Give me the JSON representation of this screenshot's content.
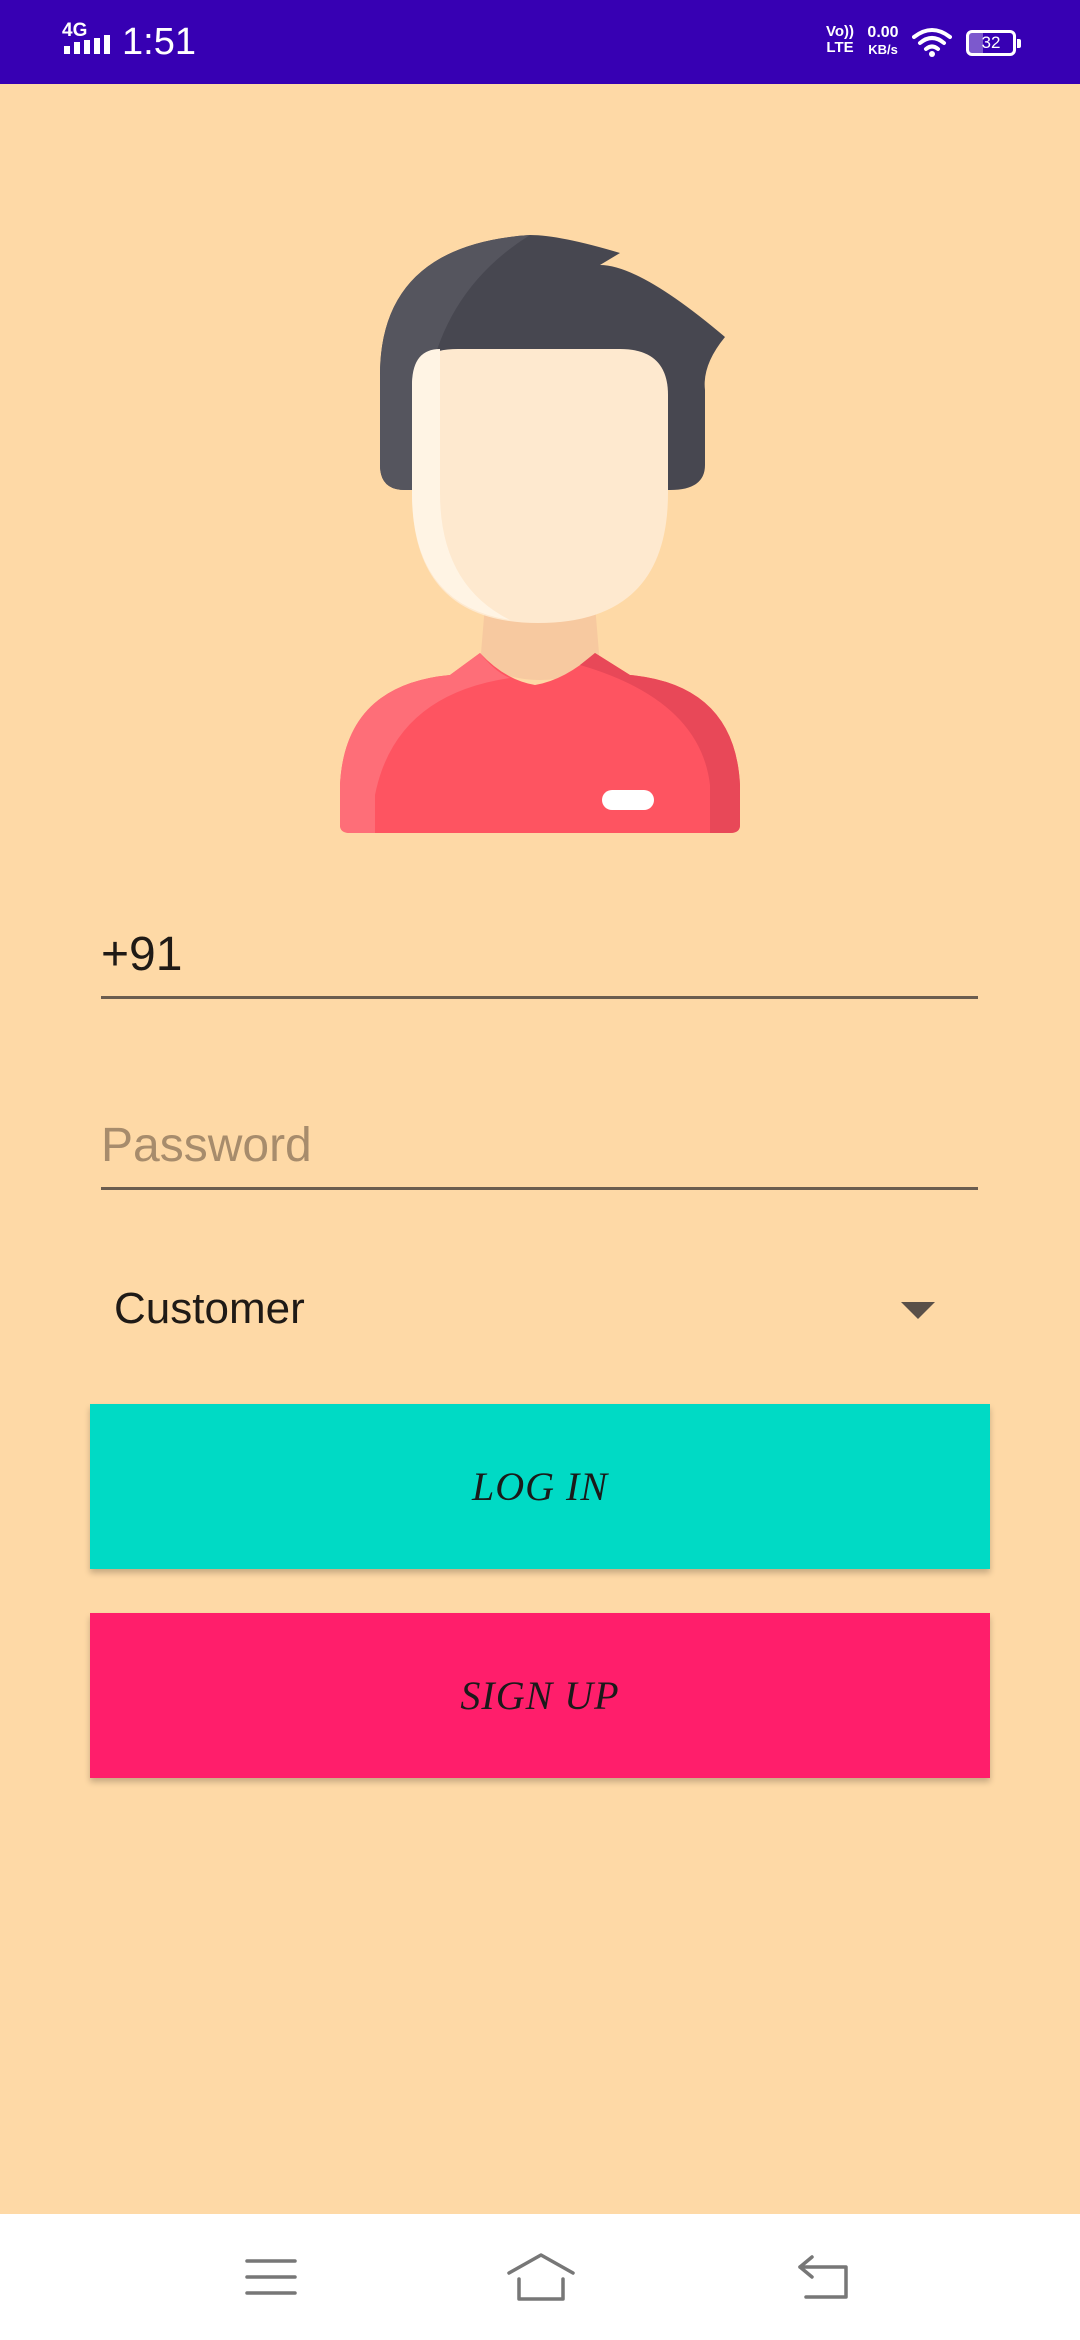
{
  "status_bar": {
    "network_type": "4G",
    "time": "1:51",
    "volte_line1": "Vo))",
    "volte_line2": "LTE",
    "speed_value": "0.00",
    "speed_unit": "KB/s",
    "battery_level": "32",
    "battery_fraction": 0.32
  },
  "form": {
    "phone_value": "+91",
    "password_placeholder": "Password",
    "role_selected": "Customer"
  },
  "buttons": {
    "login_label": "LOG IN",
    "signup_label": "SIGN UP"
  },
  "colors": {
    "status_bar": "#3700B3",
    "background": "#FED9A6",
    "login_button": "#00DAC5",
    "signup_button": "#FF1E6B",
    "avatar_hair": "#474750",
    "avatar_face": "#FEE9CF",
    "avatar_shirt": "#FE5461"
  },
  "icons": {
    "signal": "signal-icon",
    "wifi": "wifi-icon",
    "battery": "battery-icon",
    "dropdown": "caret-down-icon",
    "nav_menu": "menu-icon",
    "nav_home": "home-icon",
    "nav_back": "back-icon"
  }
}
